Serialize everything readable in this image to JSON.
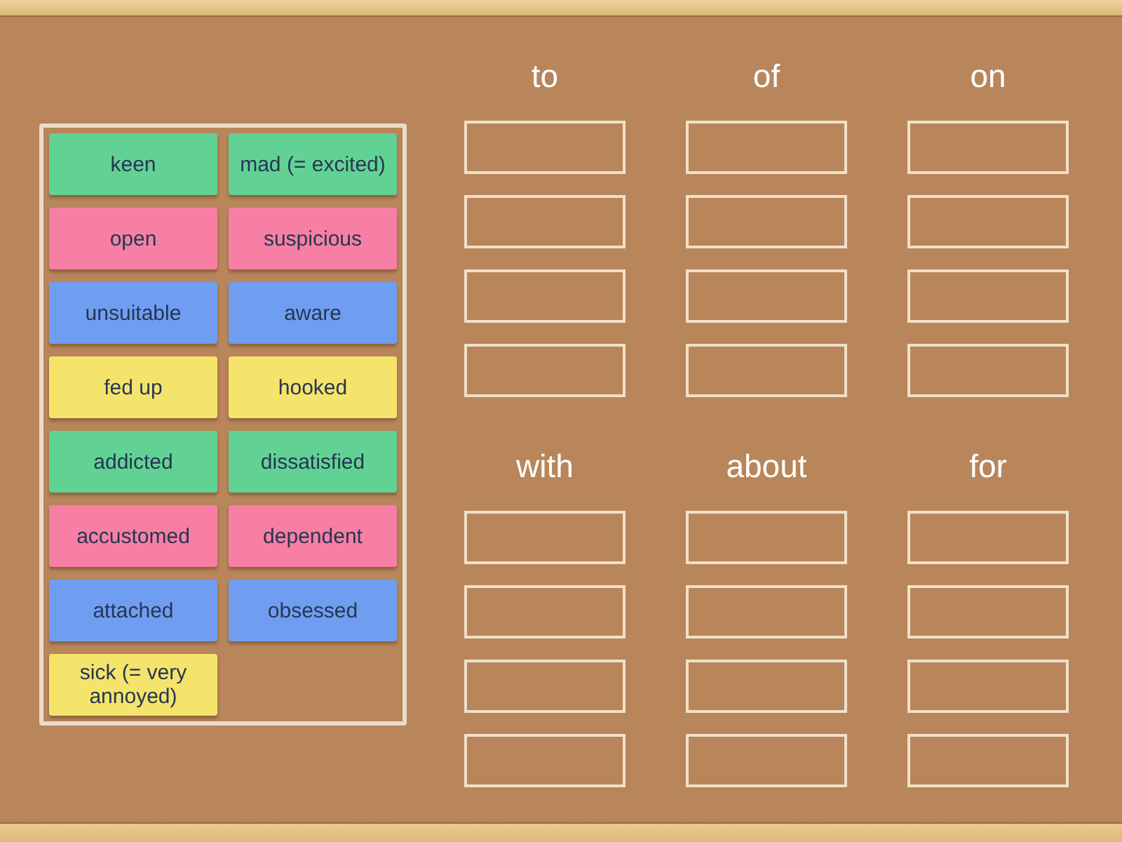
{
  "cards": [
    {
      "text": "keen",
      "color": "#62d294"
    },
    {
      "text": "mad (= excited)",
      "color": "#62d294"
    },
    {
      "text": "open",
      "color": "#f77fa3"
    },
    {
      "text": "suspicious",
      "color": "#f77fa3"
    },
    {
      "text": "unsuitable",
      "color": "#6f9ef1"
    },
    {
      "text": "aware",
      "color": "#6f9ef1"
    },
    {
      "text": "fed up",
      "color": "#f5e46c"
    },
    {
      "text": "hooked",
      "color": "#f5e46c"
    },
    {
      "text": "addicted",
      "color": "#62d294"
    },
    {
      "text": "dissatisfied",
      "color": "#62d294"
    },
    {
      "text": "accustomed",
      "color": "#f77fa3"
    },
    {
      "text": "dependent",
      "color": "#f77fa3"
    },
    {
      "text": "attached",
      "color": "#6f9ef1"
    },
    {
      "text": "obsessed",
      "color": "#6f9ef1"
    },
    {
      "text": "sick (= very annoyed)",
      "color": "#f5e46c"
    }
  ],
  "categories": [
    {
      "heading": "to"
    },
    {
      "heading": "of"
    },
    {
      "heading": "on"
    },
    {
      "heading": "with"
    },
    {
      "heading": "about"
    },
    {
      "heading": "for"
    }
  ]
}
